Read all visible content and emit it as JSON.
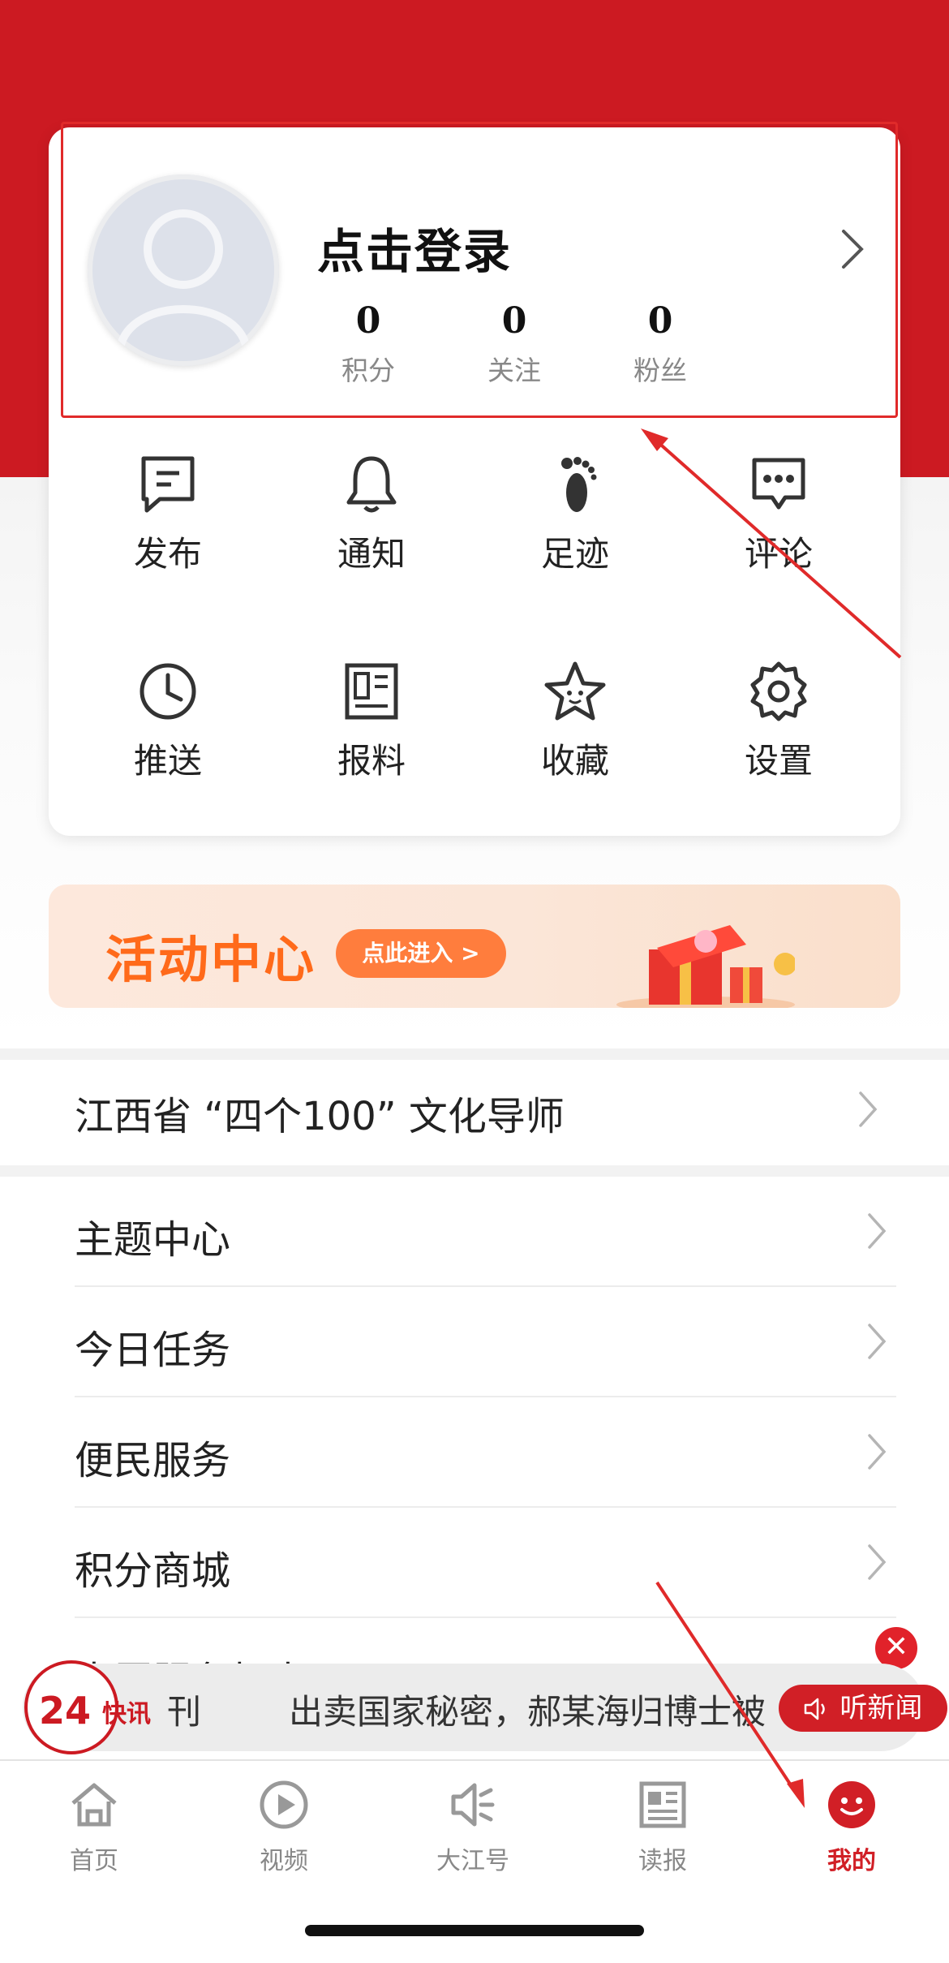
{
  "profile": {
    "login_label": "点击登录",
    "stats": [
      {
        "value": "0",
        "label": "积分"
      },
      {
        "value": "0",
        "label": "关注"
      },
      {
        "value": "0",
        "label": "粉丝"
      }
    ]
  },
  "grid": [
    {
      "label": "发布",
      "icon": "publish-icon"
    },
    {
      "label": "通知",
      "icon": "bell-icon"
    },
    {
      "label": "足迹",
      "icon": "footprint-icon"
    },
    {
      "label": "评论",
      "icon": "comment-icon"
    },
    {
      "label": "推送",
      "icon": "clock-icon"
    },
    {
      "label": "报料",
      "icon": "report-icon"
    },
    {
      "label": "收藏",
      "icon": "star-icon"
    },
    {
      "label": "设置",
      "icon": "gear-icon"
    }
  ],
  "banner": {
    "title": "活动中心",
    "button": "点此进入 >"
  },
  "featured_row": {
    "label": "江西省 “四个100” 文化导师"
  },
  "menu": [
    {
      "label": "主题中心"
    },
    {
      "label": "今日任务"
    },
    {
      "label": "便民服务"
    },
    {
      "label": "积分商城"
    },
    {
      "label": "志愿服务打卡"
    }
  ],
  "news_ticker": {
    "badge_number": "24",
    "badge_text": "快讯",
    "sub_text": "刊",
    "headline": "出卖国家秘密，郝某海归博士被",
    "listen_label": "听新闻",
    "close_symbol": "✕"
  },
  "tabbar": [
    {
      "label": "首页",
      "icon": "home-icon",
      "active": false
    },
    {
      "label": "视频",
      "icon": "play-icon",
      "active": false
    },
    {
      "label": "大江号",
      "icon": "speaker-icon",
      "active": false
    },
    {
      "label": "读报",
      "icon": "newspaper-icon",
      "active": false
    },
    {
      "label": "我的",
      "icon": "smile-icon",
      "active": true
    }
  ],
  "colors": {
    "brand_red": "#cc1a22",
    "accent_orange": "#ff6a1a",
    "annotation_red": "#e02a2a"
  }
}
